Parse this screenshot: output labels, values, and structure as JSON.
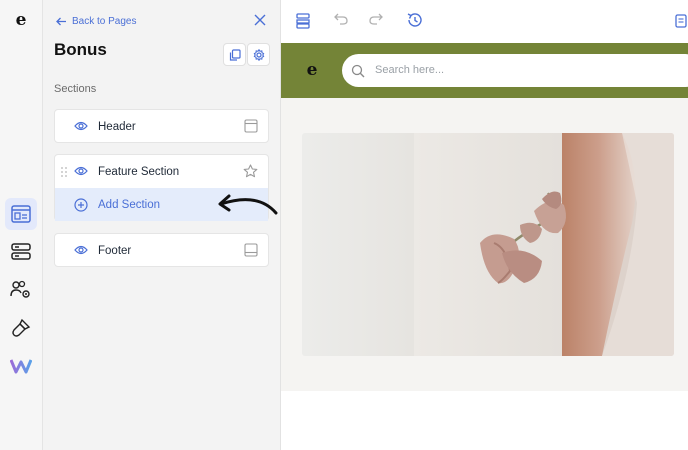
{
  "rail": {
    "logo_letter": "e",
    "items": [
      {
        "name": "pages-icon",
        "active": true
      },
      {
        "name": "sections-icon",
        "active": false
      },
      {
        "name": "users-settings-icon",
        "active": false
      },
      {
        "name": "brush-icon",
        "active": false
      },
      {
        "name": "w-logo-icon",
        "active": false
      }
    ]
  },
  "panel": {
    "back_label": "Back to Pages",
    "title": "Bonus",
    "sections_label": "Sections",
    "sections": [
      {
        "label": "Header",
        "icon": "header-layout-icon"
      },
      {
        "label": "Feature Section",
        "icon": "star-icon"
      },
      {
        "label": "Footer",
        "icon": "footer-layout-icon"
      }
    ],
    "add_section_label": "Add Section"
  },
  "preview": {
    "logo_letter": "e",
    "search": {
      "placeholder": "Search here...",
      "value": ""
    },
    "colors": {
      "header_bg": "#748437",
      "accent": "#4a6fd6",
      "hero_bg": "#f5f4f2"
    }
  }
}
